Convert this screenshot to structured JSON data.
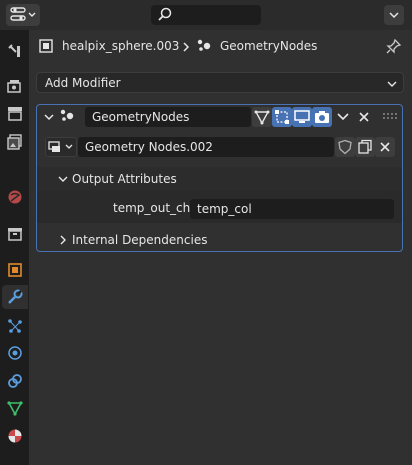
{
  "header": {
    "editor_type_icon": "properties-editor-icon",
    "search_icon": "search-icon",
    "menu_icon": "chevron-down-icon"
  },
  "tabs": [
    {
      "name": "tool-icon"
    },
    {
      "name": "render-icon"
    },
    {
      "name": "output-icon"
    },
    {
      "name": "view-layer-icon"
    },
    {
      "name": "scene-icon"
    },
    {
      "name": "world-icon"
    },
    {
      "name": "collection-icon"
    },
    {
      "name": "object-icon"
    },
    {
      "name": "modifier-icon",
      "active": true
    },
    {
      "name": "particles-icon"
    },
    {
      "name": "physics-icon"
    },
    {
      "name": "constraints-icon"
    },
    {
      "name": "object-data-icon"
    },
    {
      "name": "material-icon"
    }
  ],
  "breadcrumb": {
    "object_name": "healpix_sphere.003",
    "modifier_name": "GeometryNodes",
    "pin_icon": "pin-icon"
  },
  "add_modifier": {
    "label": "Add Modifier"
  },
  "modifier": {
    "name": "GeometryNodes",
    "node_group": "Geometry Nodes.002",
    "output_attributes": {
      "header": "Output Attributes",
      "attr_label": "temp_out_ch",
      "attr_value": "temp_col"
    },
    "internal_dependencies": "Internal Dependencies"
  },
  "colors": {
    "accent": "#4772b3",
    "background": "#303030",
    "sidebar": "#1d1d1d"
  }
}
